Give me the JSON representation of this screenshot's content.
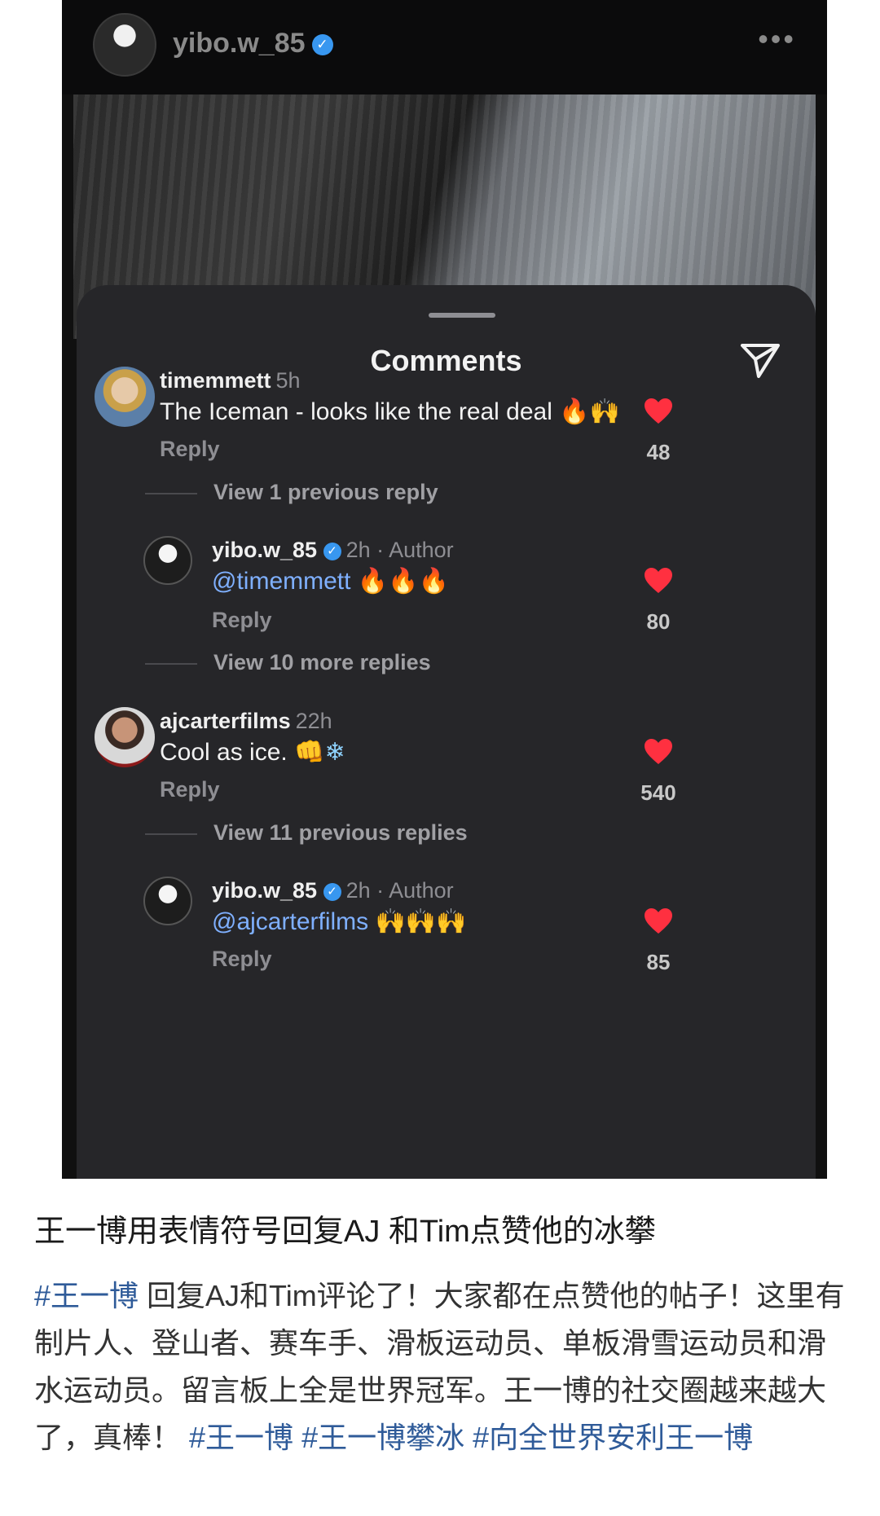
{
  "post": {
    "username": "yibo.w_85",
    "more_icon": "more-horizontal-icon"
  },
  "sheet": {
    "title": "Comments"
  },
  "comments": [
    {
      "user": "timemmett",
      "time": "5h",
      "text": "The Iceman - looks like the real deal",
      "emoji": "🔥🙌",
      "reply_label": "Reply",
      "likes": "48",
      "view_replies": "View 1 previous reply"
    },
    {
      "user": "yibo.w_85",
      "time": "2h · Author",
      "mention": "@timemmett",
      "emoji": "🔥🔥🔥",
      "reply_label": "Reply",
      "likes": "80",
      "view_replies": "View 10 more replies"
    },
    {
      "user": "ajcarterfilms",
      "time": "22h",
      "text": "Cool as ice.",
      "emoji": "👊❄",
      "reply_label": "Reply",
      "likes": "540",
      "view_replies": "View 11 previous replies"
    },
    {
      "user": "yibo.w_85",
      "time": "2h · Author",
      "mention": "@ajcarterfilms",
      "emoji": "🙌🙌🙌",
      "reply_label": "Reply",
      "likes": "85"
    }
  ],
  "caption": {
    "title": "王一博用表情符号回复AJ 和Tim点赞他的冰攀",
    "tag1": "#王一博",
    "body": " 回复AJ和Tim评论了！大家都在点赞他的帖子！这里有制片人、登山者、赛车手、滑板运动员、单板滑雪运动员和滑水运动员。留言板上全是世界冠军。王一博的社交圈越来越大了，真棒！",
    "tag2": "#王一博",
    "tag3": "#王一博攀冰",
    "tag4": "#向全世界安利王一博"
  },
  "colors": {
    "like_red": "#ff3040",
    "mention_blue": "#7fb0ff",
    "verified_blue": "#3897f0",
    "hashtag_blue": "#2f5b99"
  }
}
